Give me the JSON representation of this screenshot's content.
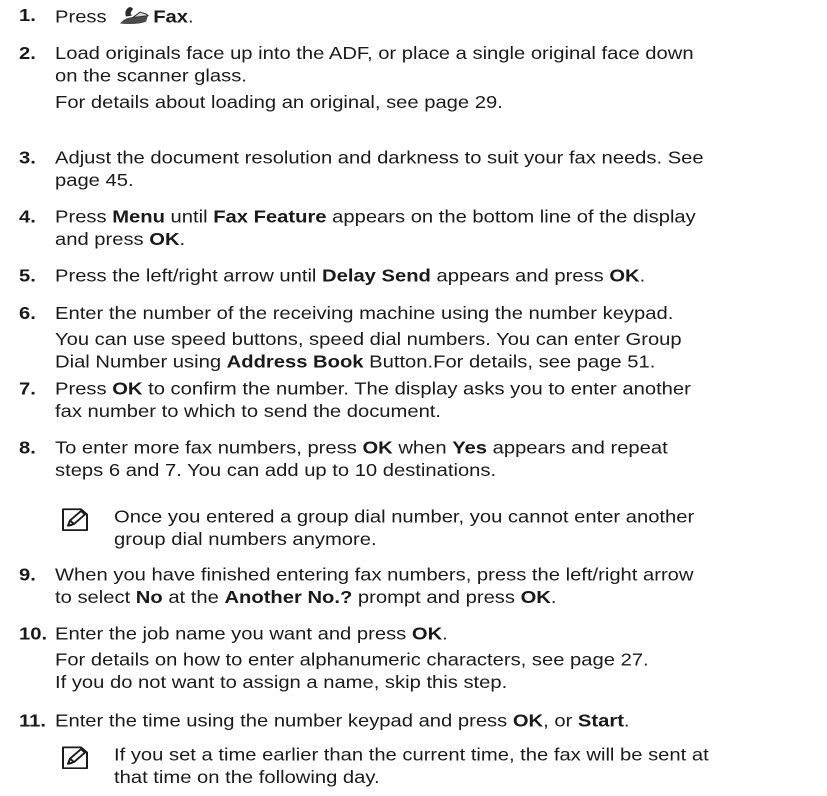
{
  "steps": [
    {
      "num": "1.",
      "lines": [
        [
          {
            "t": "Press "
          },
          {
            "icon": "fax"
          },
          {
            "t": "Fax",
            "b": true
          },
          {
            "t": "."
          }
        ]
      ]
    },
    {
      "num": "2.",
      "lines": [
        [
          {
            "t": "Load originals face up into the ADF, or place a single original face down"
          }
        ],
        [
          {
            "t": "on the scanner glass."
          }
        ]
      ],
      "sub": [
        [
          {
            "t": "For details about loading an original, see page 29."
          }
        ]
      ]
    },
    {
      "num": "3.",
      "lines": [
        [
          {
            "t": "Adjust the document resolution and darkness to suit your fax needs. See"
          }
        ],
        [
          {
            "t": "page 45."
          }
        ]
      ]
    },
    {
      "num": "4.",
      "lines": [
        [
          {
            "t": "Press "
          },
          {
            "t": "Menu",
            "b": true
          },
          {
            "t": " until "
          },
          {
            "t": "Fax Feature",
            "b": true
          },
          {
            "t": " appears on the bottom line of the display"
          }
        ],
        [
          {
            "t": "and press "
          },
          {
            "t": "OK",
            "b": true
          },
          {
            "t": "."
          }
        ]
      ]
    },
    {
      "num": "5.",
      "lines": [
        [
          {
            "t": "Press the left/right arrow until "
          },
          {
            "t": "Delay Send",
            "b": true
          },
          {
            "t": " appears and press "
          },
          {
            "t": "OK",
            "b": true
          },
          {
            "t": "."
          }
        ]
      ]
    },
    {
      "num": "6.",
      "lines": [
        [
          {
            "t": "Enter the number of the receiving machine using the number keypad."
          }
        ]
      ],
      "sub": [
        [
          {
            "t": "You can use speed buttons, speed dial numbers. You can enter Group"
          }
        ],
        [
          {
            "t": "Dial Number using "
          },
          {
            "t": "Address Book",
            "b": true
          },
          {
            "t": " Button.For details, see page 51."
          }
        ]
      ]
    },
    {
      "num": "7.",
      "lines": [
        [
          {
            "t": "Press "
          },
          {
            "t": "OK",
            "b": true
          },
          {
            "t": " to confirm the number. The display asks you to enter another"
          }
        ],
        [
          {
            "t": "fax number to which to send the document."
          }
        ]
      ]
    },
    {
      "num": "8.",
      "lines": [
        [
          {
            "t": "To enter more fax numbers, press "
          },
          {
            "t": "OK",
            "b": true
          },
          {
            "t": " when "
          },
          {
            "t": "Yes",
            "b": true
          },
          {
            "t": " appears and repeat"
          }
        ],
        [
          {
            "t": "steps 6 and 7. You can add up to 10 destinations."
          }
        ]
      ]
    },
    {
      "num": "9.",
      "lines": [
        [
          {
            "t": "When you have finished entering fax numbers, press the left/right arrow"
          }
        ],
        [
          {
            "t": "to select "
          },
          {
            "t": "No",
            "b": true
          },
          {
            "t": " at the "
          },
          {
            "t": "Another No.?",
            "b": true
          },
          {
            "t": " prompt and press "
          },
          {
            "t": "OK",
            "b": true
          },
          {
            "t": "."
          }
        ]
      ]
    },
    {
      "num": "10.",
      "lines": [
        [
          {
            "t": "Enter the job name you want and press "
          },
          {
            "t": "OK",
            "b": true
          },
          {
            "t": "."
          }
        ]
      ],
      "sub": [
        [
          {
            "t": "For details on how to enter alphanumeric characters, see page 27."
          }
        ],
        [
          {
            "t": "If you do not want to assign a name, skip this step."
          }
        ]
      ]
    },
    {
      "num": "11.",
      "lines": [
        [
          {
            "t": "Enter the time using the number keypad and press "
          },
          {
            "t": "OK",
            "b": true
          },
          {
            "t": ", or "
          },
          {
            "t": "Start",
            "b": true
          },
          {
            "t": "."
          }
        ]
      ]
    }
  ],
  "notes": [
    {
      "icon": "note-pencil-icon",
      "lines": [
        "Once you entered a group dial number, you cannot enter another",
        "group dial numbers anymore."
      ]
    },
    {
      "icon": "note-pencil-icon",
      "lines": [
        "If you set a time earlier than the current time, the fax will be sent at",
        "that time on the following day."
      ]
    }
  ]
}
